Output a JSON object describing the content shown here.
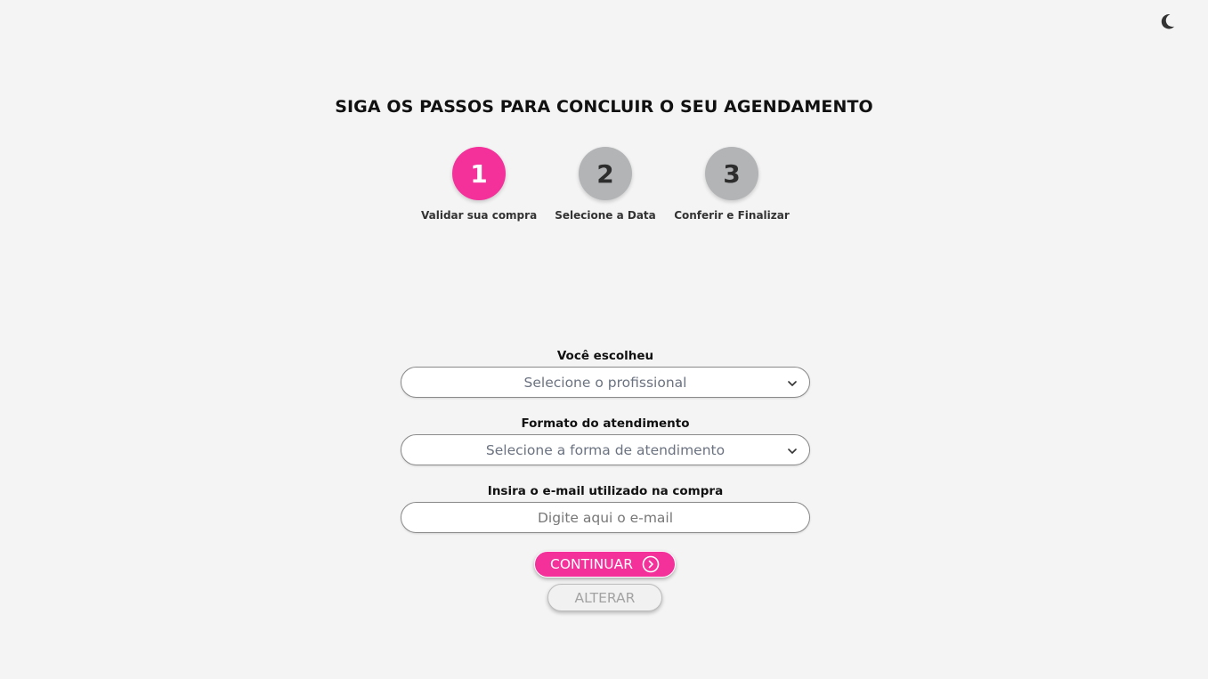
{
  "header": {
    "theme_toggle_icon": "moon-icon"
  },
  "title": "SIGA OS PASSOS PARA CONCLUIR O SEU AGENDAMENTO",
  "steps": [
    {
      "number": "1",
      "label": "Validar sua compra",
      "state": "active"
    },
    {
      "number": "2",
      "label": "Selecione a Data",
      "state": "inactive"
    },
    {
      "number": "3",
      "label": "Conferir e Finalizar",
      "state": "inactive"
    }
  ],
  "form": {
    "professional": {
      "label": "Você escolheu",
      "placeholder": "Selecione o profissional",
      "icon": "chevron-down-icon"
    },
    "format": {
      "label": "Formato do atendimento",
      "placeholder": "Selecione a forma de atendimento",
      "icon": "chevron-down-icon"
    },
    "email": {
      "label": "Insira o e-mail utilizado na compra",
      "placeholder": "Digite aqui o e-mail",
      "value": ""
    }
  },
  "buttons": {
    "continue_label": "CONTINUAR",
    "continue_icon": "arrow-right-circle-icon",
    "alter_label": "ALTERAR"
  },
  "colors": {
    "accent": "#f4309a",
    "step_inactive": "#b3b4b6",
    "background": "#f4f4f4"
  }
}
